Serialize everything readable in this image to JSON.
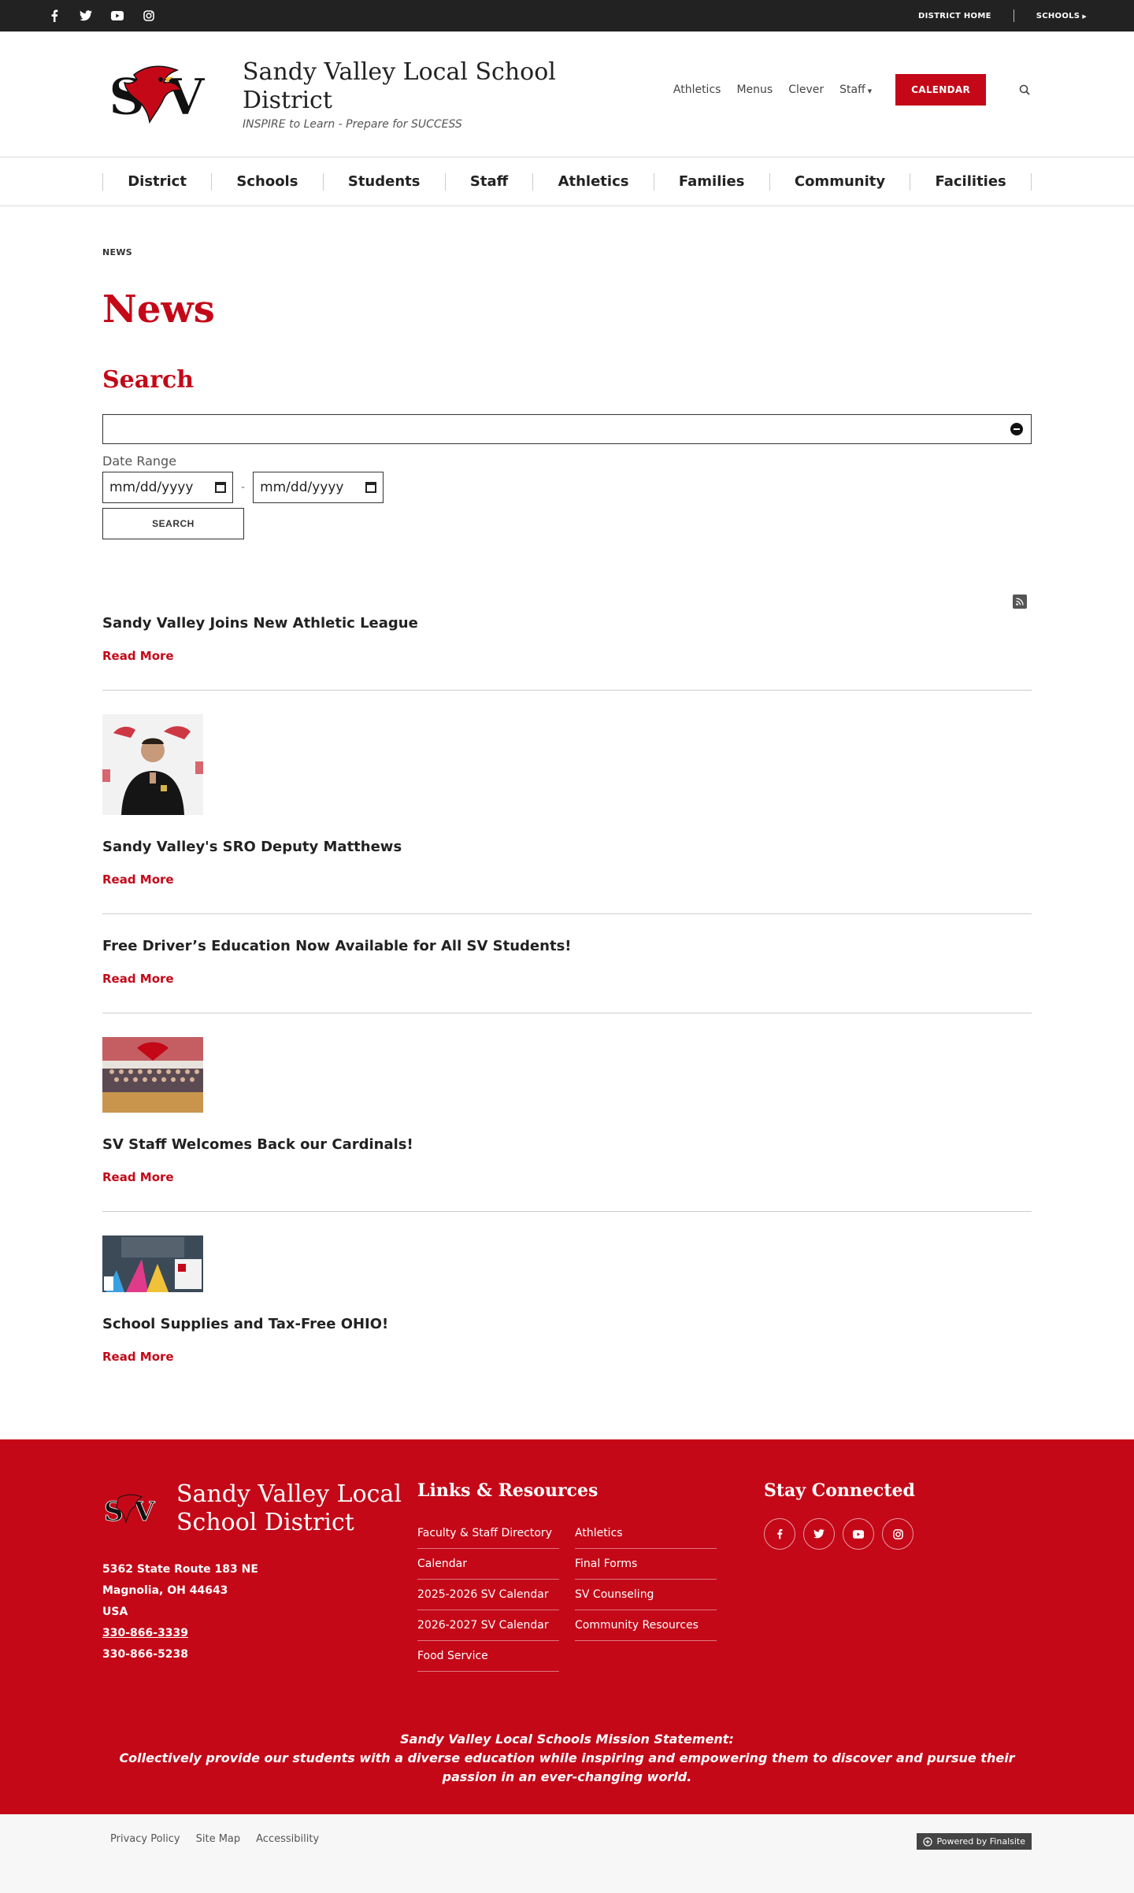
{
  "topbar": {
    "social": [
      "facebook-icon",
      "twitter-icon",
      "youtube-icon",
      "instagram-icon"
    ],
    "district_home": "DISTRICT HOME",
    "schools": "SCHOOLS"
  },
  "header": {
    "title": "Sandy Valley Local School District",
    "tagline": "INSPIRE to Learn - Prepare for SUCCESS",
    "links": [
      "Athletics",
      "Menus",
      "Clever",
      "Staff"
    ],
    "calendar_btn": "CALENDAR"
  },
  "nav": [
    "District",
    "Schools",
    "Students",
    "Staff",
    "Athletics",
    "Families",
    "Community",
    "Facilities"
  ],
  "breadcrumb": "NEWS",
  "page_title": "News",
  "search": {
    "title": "Search",
    "input_value": "",
    "date_range_label": "Date Range",
    "date_from": "mm/dd/yyyy",
    "date_to": "mm/dd/yyyy",
    "separator": "-",
    "button": "SEARCH"
  },
  "news": [
    {
      "title": "Sandy Valley Joins New Athletic League",
      "read_more": "Read More"
    },
    {
      "title": "Sandy Valley's SRO Deputy Matthews",
      "read_more": "Read More"
    },
    {
      "title": "Free Driver’s Education Now Available for All SV Students!",
      "read_more": "Read More"
    },
    {
      "title": "SV Staff Welcomes Back our Cardinals!",
      "read_more": "Read More"
    },
    {
      "title": "School Supplies and Tax-Free OHIO!",
      "read_more": "Read More"
    }
  ],
  "footer": {
    "name": "Sandy Valley Local School District",
    "address_line1": "5362 State Route 183 NE",
    "address_line2": "Magnolia, OH  44643",
    "address_line3": "USA",
    "phone": "330-866-3339",
    "fax": "330-866-5238",
    "links_title": "Links & Resources",
    "links_col1": [
      "Faculty & Staff Directory",
      "Calendar",
      "2025-2026 SV Calendar",
      "2026-2027 SV Calendar",
      "Food Service"
    ],
    "links_col2": [
      "Athletics",
      "Final Forms",
      "SV Counseling",
      "Community Resources"
    ],
    "connected_title": "Stay Connected",
    "mission_title": "Sandy Valley Local Schools Mission Statement:",
    "mission_text": "Collectively provide our students with a diverse education while inspiring and empowering them to discover and pursue their passion in an ever-changing world."
  },
  "bottom": {
    "privacy": "Privacy Policy",
    "sitemap": "Site Map",
    "accessibility": "Accessibility",
    "powered": "Powered by Finalsite"
  },
  "colors": {
    "brand_red": "#c40818",
    "topbar": "#222222"
  }
}
